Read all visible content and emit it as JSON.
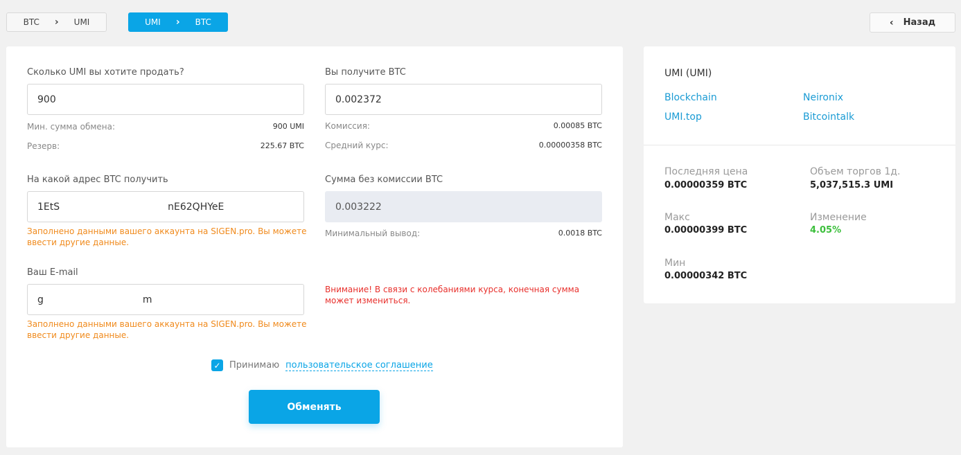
{
  "tabs": {
    "btc_umi": {
      "from": "BTC",
      "to": "UMI"
    },
    "umi_btc": {
      "from": "UMI",
      "to": "BTC"
    }
  },
  "back_label": "Назад",
  "form": {
    "sell": {
      "label": "Сколько UMI вы хотите продать?",
      "value": "900",
      "min_label": "Мин. сумма обмена:",
      "min_value": "900 UMI",
      "reserve_label": "Резерв:",
      "reserve_value": "225.67 BTC"
    },
    "receive": {
      "label": "Вы получите BTC",
      "value": "0.002372",
      "fee_label": "Комиссия:",
      "fee_value": "0.00085 BTC",
      "rate_label": "Средний курс:",
      "rate_value": "0.00000358 BTC"
    },
    "address": {
      "label": "На какой адрес BTC получить",
      "value_start": "1EtS",
      "value_end": "nE62QHYeE",
      "hint": "Заполнено данными вашего аккаунта на SIGEN.pro. Вы можете ввести другие данные."
    },
    "net_amount": {
      "label": "Сумма без комиссии BTC",
      "value": "0.003222",
      "min_withdraw_label": "Минимальный вывод:",
      "min_withdraw_value": "0.0018 BTC"
    },
    "email": {
      "label": "Ваш E-mail",
      "value_start": "g",
      "value_end": "m",
      "hint": "Заполнено данными вашего аккаунта на SIGEN.pro. Вы можете ввести другие данные."
    },
    "warning": "Внимание! В связи с колебаниями курса, конечная сумма может измениться.",
    "agree_text": "Принимаю",
    "agree_link": "пользовательское соглашение",
    "submit": "Обменять"
  },
  "info": {
    "title": "UMI (UMI)",
    "links": [
      "Blockchain",
      "Neironix",
      "UMI.top",
      "Bitcointalk"
    ],
    "stats": {
      "last_price_label": "Последняя цена",
      "last_price_value": "0.00000359 BTC",
      "volume_label": "Объем торгов 1д.",
      "volume_value": "5,037,515.3 UMI",
      "max_label": "Макс",
      "max_value": "0.00000399 BTC",
      "change_label": "Изменение",
      "change_value": "4.05%",
      "min_label": "Мин",
      "min_value": "0.00000342 BTC"
    }
  },
  "colors": {
    "accent": "#0aa5e6",
    "link": "#1a9bd4",
    "hint": "#f08a1c",
    "warning": "#e8302c",
    "positive": "#3cbf3c"
  }
}
